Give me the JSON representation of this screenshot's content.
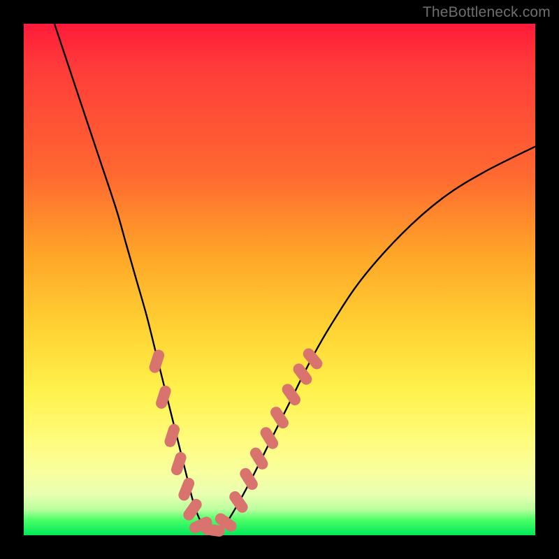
{
  "watermark": "TheBottleneck.com",
  "colors": {
    "frame": "#000000",
    "gradient_top": "#ff1a3a",
    "gradient_mid": "#ffd433",
    "gradient_bottom": "#00e85a",
    "curve_stroke": "#000000",
    "marker_fill": "#d9736e"
  },
  "chart_data": {
    "type": "line",
    "title": "",
    "xlabel": "",
    "ylabel": "",
    "xlim": [
      0,
      100
    ],
    "ylim": [
      0,
      100
    ],
    "grid": false,
    "legend": null,
    "series": [
      {
        "name": "bottleneck-curve",
        "x": [
          6,
          10,
          14,
          18,
          20,
          22,
          24,
          26,
          28,
          30,
          32,
          33,
          34,
          35,
          36,
          38,
          40,
          44,
          48,
          52,
          56,
          60,
          66,
          74,
          82,
          90,
          100
        ],
        "y": [
          100,
          88,
          76,
          64,
          57,
          50,
          43,
          35,
          27,
          19,
          11,
          7,
          4,
          2,
          1,
          1,
          3,
          10,
          18,
          26,
          34,
          41,
          50,
          59,
          66,
          71,
          76
        ]
      }
    ],
    "markers": [
      {
        "x": 26.0,
        "y": 34.0,
        "shape": "pill",
        "angle": -72
      },
      {
        "x": 27.3,
        "y": 27.0,
        "shape": "pill",
        "angle": -72
      },
      {
        "x": 29.0,
        "y": 19.5,
        "shape": "pill",
        "angle": -72
      },
      {
        "x": 30.3,
        "y": 14.0,
        "shape": "pill",
        "angle": -72
      },
      {
        "x": 31.8,
        "y": 9.0,
        "shape": "pill",
        "angle": -68
      },
      {
        "x": 33.0,
        "y": 5.0,
        "shape": "pill",
        "angle": -55
      },
      {
        "x": 34.6,
        "y": 2.0,
        "shape": "pill",
        "angle": -25
      },
      {
        "x": 37.0,
        "y": 1.0,
        "shape": "pill",
        "angle": 8
      },
      {
        "x": 39.5,
        "y": 2.5,
        "shape": "pill",
        "angle": 35
      },
      {
        "x": 42.0,
        "y": 6.5,
        "shape": "pill",
        "angle": 55
      },
      {
        "x": 44.0,
        "y": 11.0,
        "shape": "pill",
        "angle": 58
      },
      {
        "x": 46.0,
        "y": 15.0,
        "shape": "pill",
        "angle": 58
      },
      {
        "x": 48.0,
        "y": 19.0,
        "shape": "pill",
        "angle": 58
      },
      {
        "x": 50.0,
        "y": 23.0,
        "shape": "pill",
        "angle": 57
      },
      {
        "x": 52.3,
        "y": 27.5,
        "shape": "pill",
        "angle": 55
      },
      {
        "x": 54.5,
        "y": 31.5,
        "shape": "pill",
        "angle": 53
      },
      {
        "x": 56.5,
        "y": 34.5,
        "shape": "pill",
        "angle": 50
      }
    ],
    "annotations": []
  }
}
